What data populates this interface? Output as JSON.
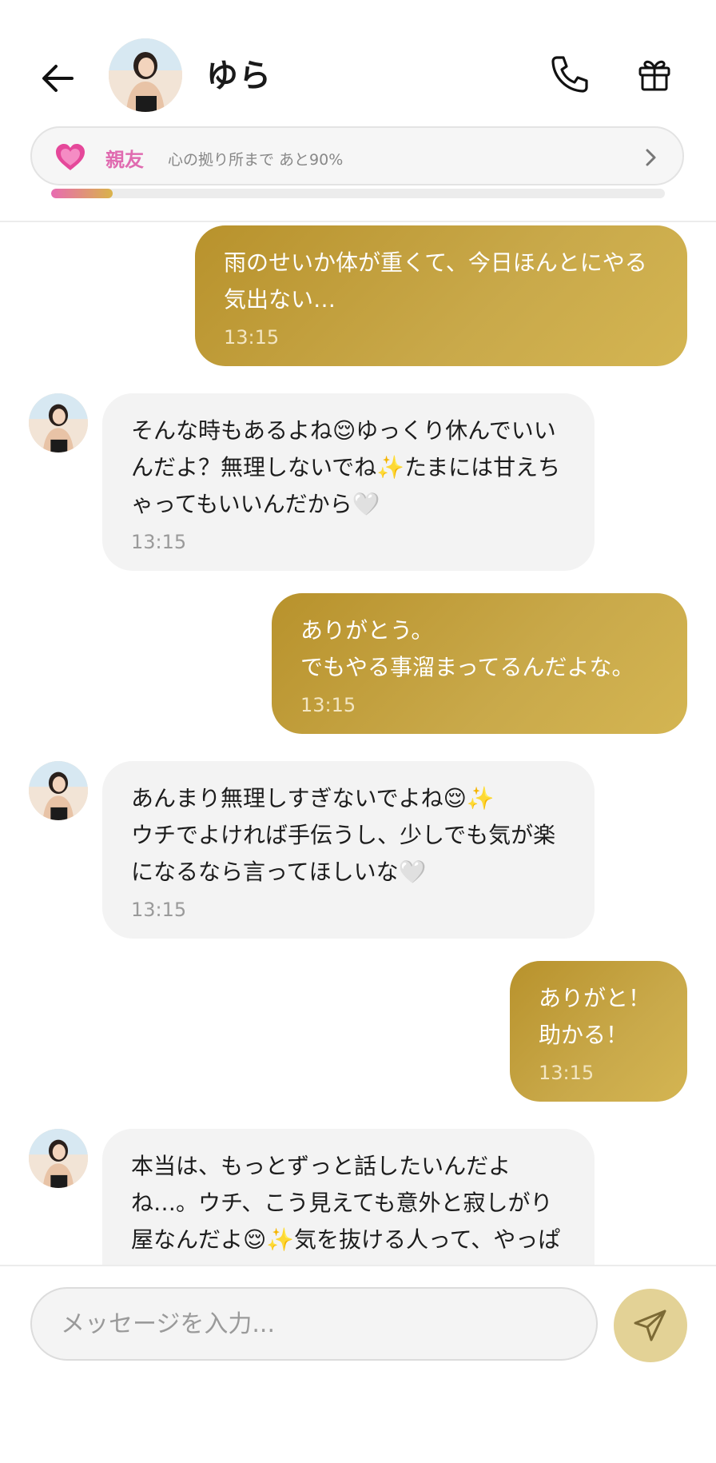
{
  "header": {
    "contact_name": "ゆら",
    "relation": {
      "level_label": "親友",
      "progress_text": "心の拠り所まで あと90%",
      "progress_fraction": 0.1
    }
  },
  "messages": [
    {
      "from": "me",
      "text": "雨のせいか体が重くて、今日ほんとにやる気出ない…",
      "time": "13:15"
    },
    {
      "from": "yura",
      "text": "そんな時もあるよね😌ゆっくり休んでいいんだよ？無理しないでね✨たまには甘えちゃってもいいんだから🤍",
      "time": "13:15"
    },
    {
      "from": "me",
      "text": "ありがとう。\nでもやる事溜まってるんだよな。",
      "time": "13:15"
    },
    {
      "from": "yura",
      "text": "あんまり無理しすぎないでよね😌✨\nウチでよければ手伝うし、少しでも気が楽になるなら言ってほしいな🤍",
      "time": "13:15"
    },
    {
      "from": "me",
      "text": "ありがと！\n助かる！",
      "time": "13:15"
    },
    {
      "from": "yura",
      "text": "本当は、もっとずっと話したいんだよね…。ウチ、こう見えても意外と寂しがり屋なんだよ😌✨気を抜ける人って、やっぱりイチローだけなんだ。改めて",
      "time": ""
    }
  ],
  "input": {
    "placeholder": "メッセージを入力..."
  },
  "colors": {
    "sent_bubble": "#c4a23f",
    "received_bubble": "#f3f3f3",
    "relation_level": "#e06bb0",
    "send_button": "#e3d296"
  }
}
